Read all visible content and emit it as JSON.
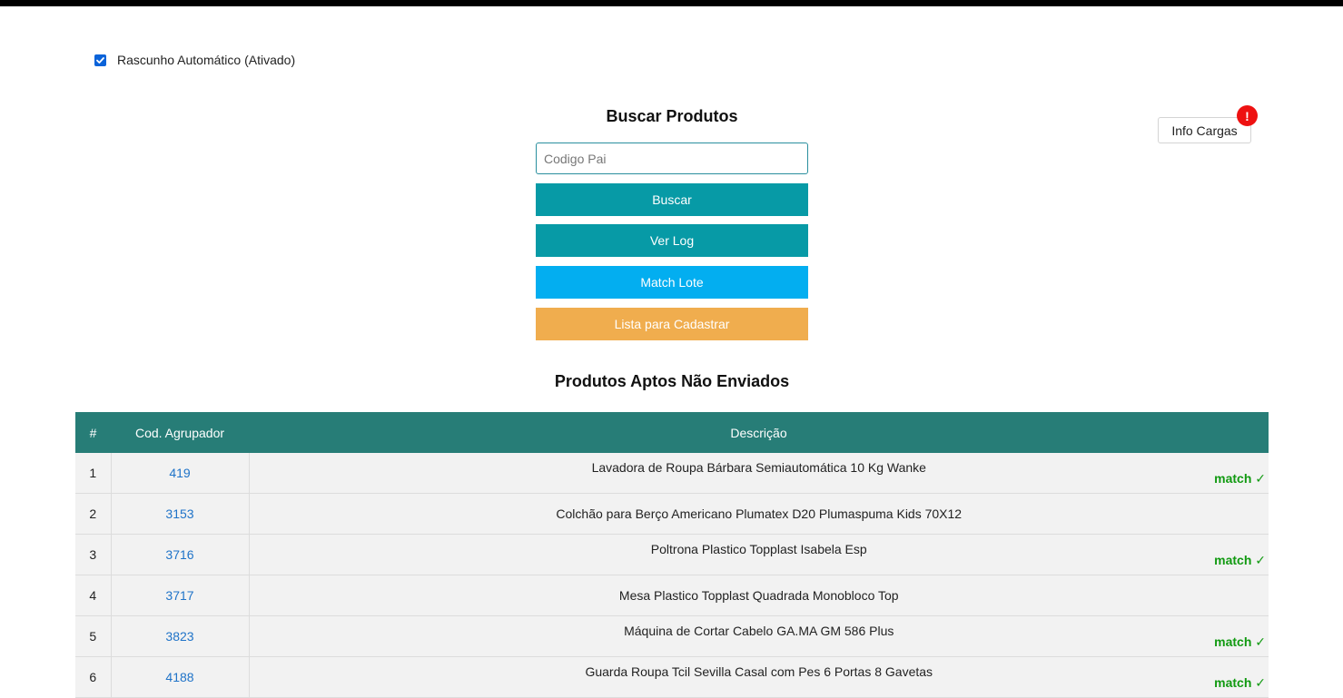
{
  "draft": {
    "label": "Rascunho Automático (Ativado)",
    "checked": true
  },
  "info_cargas": {
    "label": "Info Cargas",
    "badge": "!"
  },
  "search": {
    "title": "Buscar Produtos",
    "placeholder": "Codigo Pai",
    "value": ""
  },
  "buttons": {
    "buscar": "Buscar",
    "ver_log": "Ver Log",
    "match_lote": "Match Lote",
    "lista_cadastrar": "Lista para Cadastrar"
  },
  "table": {
    "title": "Produtos Aptos Não Enviados",
    "headers": {
      "num": "#",
      "code": "Cod. Agrupador",
      "desc": "Descrição"
    },
    "match_label": "match ✓",
    "rows": [
      {
        "num": "1",
        "code": "419",
        "desc": "Lavadora de Roupa Bárbara Semiautomática 10 Kg Wanke",
        "match": true
      },
      {
        "num": "2",
        "code": "3153",
        "desc": "Colchão para Berço Americano Plumatex D20 Plumaspuma Kids 70X12",
        "match": false
      },
      {
        "num": "3",
        "code": "3716",
        "desc": "Poltrona Plastico Topplast Isabela Esp",
        "match": true
      },
      {
        "num": "4",
        "code": "3717",
        "desc": "Mesa Plastico Topplast Quadrada Monobloco Top",
        "match": false
      },
      {
        "num": "5",
        "code": "3823",
        "desc": "Máquina de Cortar Cabelo GA.MA GM 586 Plus",
        "match": true
      },
      {
        "num": "6",
        "code": "4188",
        "desc": "Guarda Roupa Tcil Sevilla Casal com Pes 6 Portas 8 Gavetas",
        "match": true
      }
    ]
  },
  "colors": {
    "teal": "#079aa6",
    "blue": "#03aef0",
    "orange": "#f0ad4e",
    "header": "#277d77",
    "match": "#119a11",
    "link": "#1f73c8"
  }
}
